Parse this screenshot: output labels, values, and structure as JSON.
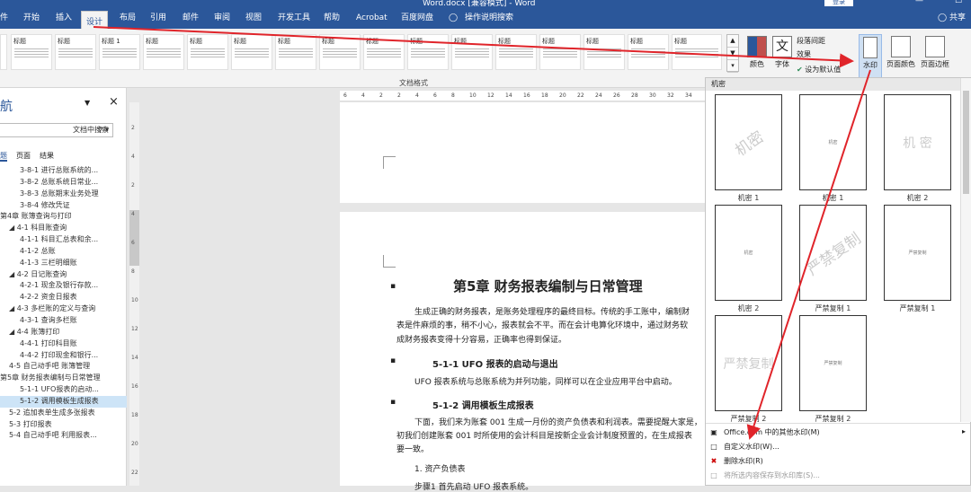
{
  "titlebar": {
    "title": "Word.docx [兼容模式] - Word",
    "login": "登录",
    "minimize": "—",
    "maximize": "☐"
  },
  "menu": {
    "tabs": [
      "件",
      "开始",
      "插入",
      "设计",
      "布局",
      "引用",
      "邮件",
      "审阅",
      "视图",
      "开发工具",
      "帮助",
      "Acrobat",
      "百度网盘",
      "操作说明搜索"
    ],
    "active": "设计",
    "share": "共享"
  },
  "ribbon": {
    "style_heads": [
      "标题",
      "标题",
      "标题 1",
      "标题",
      "标题",
      "标题",
      "标题",
      "标题",
      "标题",
      "标题",
      "标题",
      "标题",
      "标题",
      "标题",
      "标题",
      "标题"
    ],
    "group_label": "文档格式",
    "colors_label": "颜色",
    "fonts_label": "字体",
    "para_spacing": "段落间距",
    "effects": "效果",
    "set_default": "设为默认值",
    "watermark_label": "水印",
    "page_color_label": "页面颜色",
    "page_border_label": "页面边框"
  },
  "nav": {
    "title": "航",
    "search_placeholder": "文档中搜索",
    "tabs": [
      "题",
      "页面",
      "结果"
    ],
    "items": [
      "3-8-1 进行总账系统的...",
      "3-8-2 总账系统日常业...",
      "3-8-3 总账期末业务处理",
      "3-8-4 修改凭证",
      "第4章 账簿查询与打印",
      "◢ 4-1 科目账查询",
      "4-1-1 科目汇总表和余...",
      "4-1-2 总账",
      "4-1-3 三栏明细账",
      "◢ 4-2 日记账查询",
      "4-2-1 现金及银行存款...",
      "4-2-2 资金日报表",
      "◢ 4-3 多栏账的定义与查询",
      "4-3-1 查询多栏账",
      "◢ 4-4 账簿打印",
      "4-4-1 打印科目账",
      "4-4-2 打印现金和银行...",
      "4-5 自己动手吧 账簿管理",
      "第5章 财务报表编制与日常管理",
      "5-1-1 UFO报表的启动...",
      "5-1-2 调用模板生成报表",
      "5-2 追加表单生成多张报表",
      "5-3 打印报表",
      "5-4 自己动手吧 利用报表..."
    ],
    "indents": [
      22,
      22,
      22,
      22,
      0,
      10,
      22,
      22,
      22,
      10,
      22,
      22,
      10,
      22,
      10,
      22,
      22,
      10,
      0,
      22,
      22,
      10,
      10,
      10
    ]
  },
  "ruler": {
    "h": [
      "6",
      "4",
      "2",
      "2",
      "4",
      "6",
      "8",
      "10",
      "12",
      "14",
      "16",
      "18",
      "20",
      "22",
      "24",
      "26",
      "28",
      "30",
      "32",
      "34"
    ],
    "v": [
      "2",
      "4",
      "2",
      "4",
      "6",
      "8",
      "10",
      "12",
      "14",
      "16",
      "18",
      "20",
      "22"
    ]
  },
  "doc": {
    "chapter": "第5章  财务报表编制与日常管理",
    "p1": [
      "生成正确的财务报表，是账务处理程序的最终目标。传统的手工账中，编制财",
      "表是件麻烦的事，稍不小心，报表就会不平。而在会计电算化环境中，通过财务软",
      "成财务报表变得十分容易，正确率也得到保证。"
    ],
    "h1": "5-1-1 UFO 报表的启动与退出",
    "p2": "UFO 报表系统与总账系统为并列功能，同样可以在企业应用平台中启动。",
    "h2": "5-1-2 调用模板生成报表",
    "p3": [
      "下面，我们来为账套 001 生成一月份的资产负债表和利润表。需要提醒大家是，",
      "初我们创建账套 001 时所使用的会计科目是按新企业会计制度预置的，在生成报表",
      "要一致。"
    ],
    "list1": "1. 资产负债表",
    "step": "步骤1 首先启动 UFO 报表系统。"
  },
  "gallery": {
    "header": "机密",
    "items": [
      {
        "caption": "机密 1",
        "text": "机密",
        "style": "diag"
      },
      {
        "caption": "机密 1",
        "text": "机密",
        "style": "small"
      },
      {
        "caption": "机密 2",
        "text": "机 密",
        "style": "plain"
      },
      {
        "caption": "机密 2",
        "text": "机密",
        "style": "small"
      },
      {
        "caption": "严禁复制 1",
        "text": "严禁复制",
        "style": "diag"
      },
      {
        "caption": "严禁复制 1",
        "text": "严禁复制",
        "style": "small"
      },
      {
        "caption": "严禁复制 2",
        "text": "严禁复制",
        "style": "plain"
      },
      {
        "caption": "严禁复制 2",
        "text": "严禁复制",
        "style": "small"
      }
    ],
    "menu": [
      "Office.com 中的其他水印(M)",
      "自定义水印(W)...",
      "删除水印(R)",
      "将所选内容保存到水印库(S)..."
    ]
  }
}
